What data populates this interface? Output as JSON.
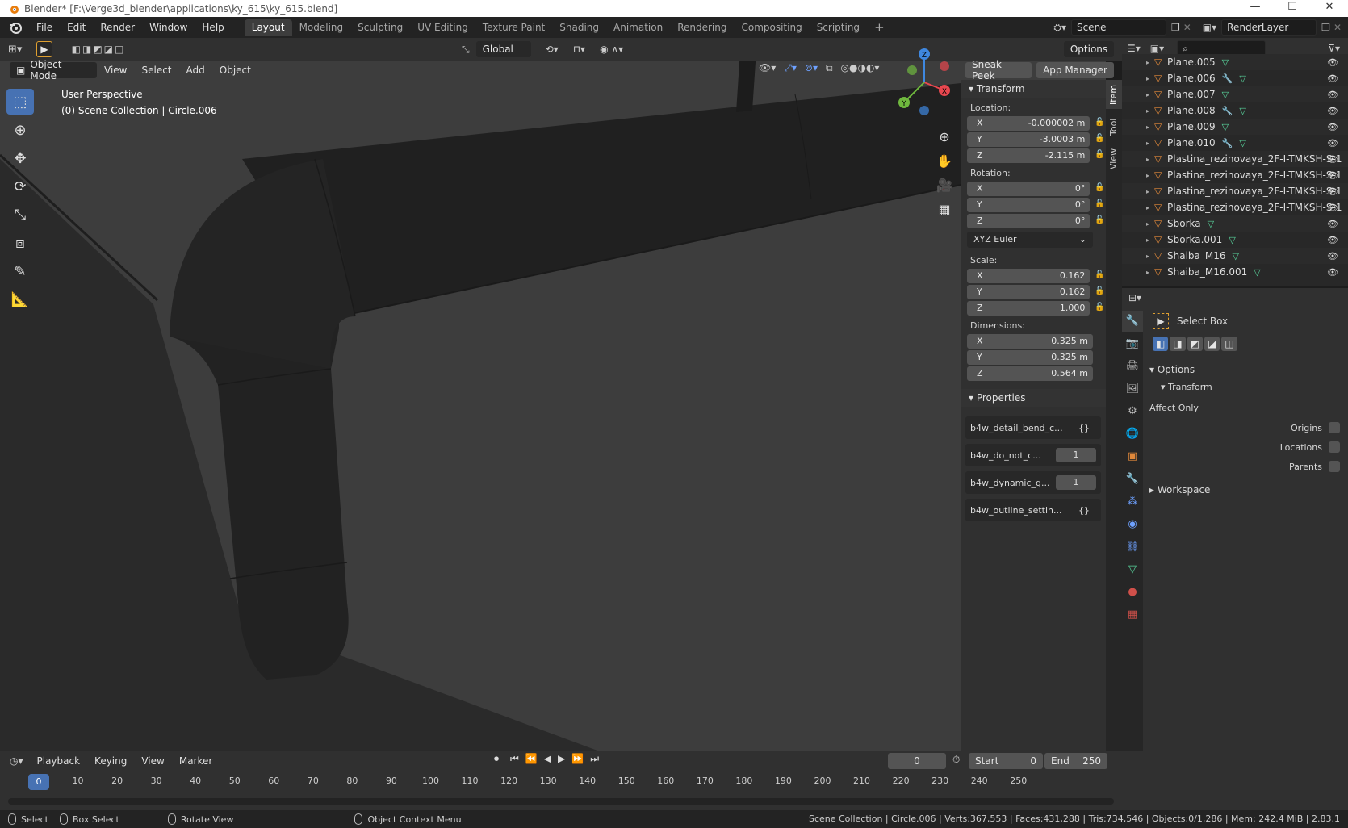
{
  "window": {
    "title": "Blender* [F:\\Verge3d_blender\\applications\\ky_615\\ky_615.blend]",
    "controls": [
      "—",
      "☐",
      "✕"
    ]
  },
  "menu": [
    "File",
    "Edit",
    "Render",
    "Window",
    "Help"
  ],
  "workspaces": [
    "Layout",
    "Modeling",
    "Sculpting",
    "UV Editing",
    "Texture Paint",
    "Shading",
    "Animation",
    "Rendering",
    "Compositing",
    "Scripting"
  ],
  "active_workspace": "Layout",
  "scene_name": "Scene",
  "render_layer": "RenderLayer",
  "tool_header": {
    "transform_orientation": "Global",
    "options_label": "Options"
  },
  "viewport_header": {
    "mode": "Object Mode",
    "menus": [
      "View",
      "Select",
      "Add",
      "Object"
    ],
    "sneak_peek": "Sneak Peek",
    "app_manager": "App Manager"
  },
  "viewport": {
    "perspective": "User Perspective",
    "collection": "(0) Scene Collection | Circle.006"
  },
  "gizmo": {
    "x": "X",
    "y": "Y",
    "z": "Z"
  },
  "npanel": {
    "tabs": [
      "Item",
      "Tool",
      "View"
    ],
    "transform_title": "Transform",
    "location_label": "Location:",
    "location": [
      {
        "axis": "X",
        "value": "-0.000002 m"
      },
      {
        "axis": "Y",
        "value": "-3.0003 m"
      },
      {
        "axis": "Z",
        "value": "-2.115 m"
      }
    ],
    "rotation_label": "Rotation:",
    "rotation": [
      {
        "axis": "X",
        "value": "0°"
      },
      {
        "axis": "Y",
        "value": "0°"
      },
      {
        "axis": "Z",
        "value": "0°"
      }
    ],
    "rotation_mode": "XYZ Euler",
    "scale_label": "Scale:",
    "scale": [
      {
        "axis": "X",
        "value": "0.162"
      },
      {
        "axis": "Y",
        "value": "0.162"
      },
      {
        "axis": "Z",
        "value": "1.000"
      }
    ],
    "dimensions_label": "Dimensions:",
    "dimensions": [
      {
        "axis": "X",
        "value": "0.325 m"
      },
      {
        "axis": "Y",
        "value": "0.325 m"
      },
      {
        "axis": "Z",
        "value": "0.564 m"
      }
    ],
    "properties_title": "Properties",
    "properties": [
      {
        "name": "b4w_detail_bend_c...",
        "value": "{}"
      },
      {
        "name": "b4w_do_not_c...",
        "value": "1"
      },
      {
        "name": "b4w_dynamic_g...",
        "value": "1"
      },
      {
        "name": "b4w_outline_settin...",
        "value": "{}"
      }
    ]
  },
  "outliner": {
    "items": [
      {
        "name": "Plane.005",
        "mod": false,
        "mesh": true
      },
      {
        "name": "Plane.006",
        "mod": true,
        "mesh": true
      },
      {
        "name": "Plane.007",
        "mod": false,
        "mesh": true
      },
      {
        "name": "Plane.008",
        "mod": true,
        "mesh": true
      },
      {
        "name": "Plane.009",
        "mod": false,
        "mesh": true
      },
      {
        "name": "Plane.010",
        "mod": true,
        "mesh": true
      },
      {
        "name": "Plastina_rezinovaya_2F-I-TMKSH-S-1",
        "mod": false,
        "mesh": false
      },
      {
        "name": "Plastina_rezinovaya_2F-I-TMKSH-S-1",
        "mod": false,
        "mesh": false
      },
      {
        "name": "Plastina_rezinovaya_2F-I-TMKSH-S-1",
        "mod": false,
        "mesh": false
      },
      {
        "name": "Plastina_rezinovaya_2F-I-TMKSH-S-1",
        "mod": false,
        "mesh": false
      },
      {
        "name": "Sborka",
        "mod": false,
        "mesh": true
      },
      {
        "name": "Sborka.001",
        "mod": false,
        "mesh": true
      },
      {
        "name": "Shaiba_M16",
        "mod": false,
        "mesh": true
      },
      {
        "name": "Shaiba_M16.001",
        "mod": false,
        "mesh": true
      }
    ]
  },
  "properties_editor": {
    "tool_name": "Select Box",
    "options": "Options",
    "transform": "Transform",
    "affect_only": "Affect Only",
    "origins": "Origins",
    "locations": "Locations",
    "parents": "Parents",
    "workspace": "Workspace"
  },
  "timeline": {
    "menus": [
      "Playback",
      "Keying",
      "View",
      "Marker"
    ],
    "current_frame": "0",
    "start_label": "Start",
    "start": "0",
    "end_label": "End",
    "end": "250",
    "ticks": [
      "0",
      "10",
      "20",
      "30",
      "40",
      "50",
      "60",
      "70",
      "80",
      "90",
      "100",
      "110",
      "120",
      "130",
      "140",
      "150",
      "160",
      "170",
      "180",
      "190",
      "200",
      "210",
      "220",
      "230",
      "240",
      "250"
    ]
  },
  "statusbar": {
    "select": "Select",
    "box_select": "Box Select",
    "rotate_view": "Rotate View",
    "context_menu": "Object Context Menu",
    "stats": "Scene Collection | Circle.006 | Verts:367,553 | Faces:431,288 | Tris:734,546 | Objects:0/1,286 | Mem: 242.4 MiB | 2.83.1"
  },
  "colors": {
    "accent": "#4772b3",
    "object_orange": "#e0883a",
    "mesh_green": "#58d49c",
    "modifier_blue": "#6ea1ff",
    "axis_x": "#e8474f",
    "axis_y": "#6fb83e",
    "axis_z": "#3f88e0"
  }
}
